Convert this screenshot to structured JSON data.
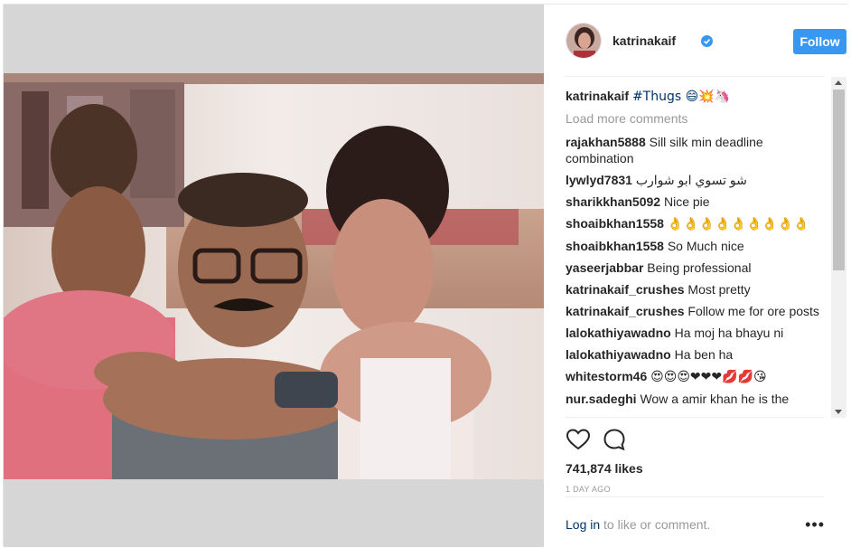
{
  "post": {
    "username": "katrinakaif",
    "follow_label": "Follow",
    "caption_user": "katrinakaif",
    "caption_text": "#Thugs 😄💥🦄",
    "load_more": "Load more comments",
    "comments": [
      {
        "user": "rajakhan5888",
        "text": "Sill silk min deadline combination"
      },
      {
        "user": "lywlyd7831",
        "text": "شو تسوي ابو شوارب"
      },
      {
        "user": "sharikkhan5092",
        "text": "Nice pie"
      },
      {
        "user": "shoaibkhan1558",
        "text": "👌👌👌👌👌👌👌👌👌"
      },
      {
        "user": "shoaibkhan1558",
        "text": "So Much nice"
      },
      {
        "user": "yaseerjabbar",
        "text": "Being professional"
      },
      {
        "user": "katrinakaif_crushes",
        "text": "Most pretty"
      },
      {
        "user": "katrinakaif_crushes",
        "text": "Follow me for ore posts"
      },
      {
        "user": "lalokathiyawadno",
        "text": "Ha moj ha bhayu ni"
      },
      {
        "user": "lalokathiyawadno",
        "text": "Ha ben ha"
      },
      {
        "user": "whitestorm46",
        "text": "😍😍😍❤❤❤💋💋😘"
      },
      {
        "user": "nur.sadeghi",
        "text": "Wow a amir khan he is the"
      }
    ],
    "likes": "741,874 likes",
    "time": "1 DAY AGO",
    "login_link": "Log in",
    "login_text": " to like or comment.",
    "more_label": "•••"
  },
  "icons": {
    "heart": "heart-icon",
    "comment": "comment-icon",
    "verified": "verified-badge-icon",
    "more": "more-options-icon"
  },
  "colors": {
    "follow_button": "#3897f0",
    "verified": "#3897f0",
    "photo_frame": "#d6d6d6"
  }
}
